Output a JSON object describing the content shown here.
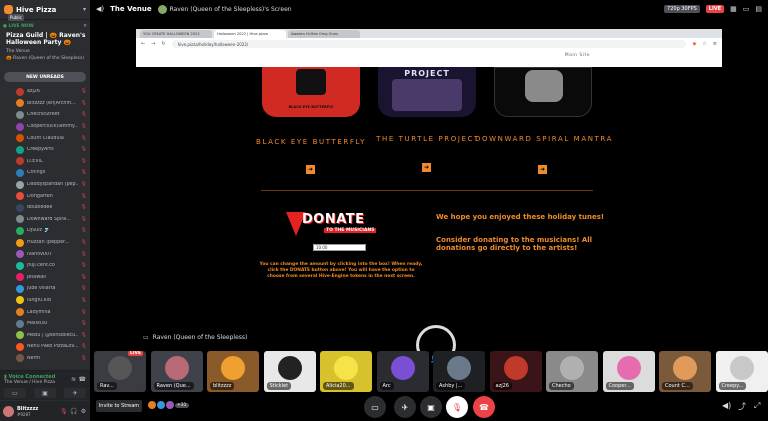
{
  "colors": {
    "accent_orange": "#f08a2a",
    "live_red": "#ed4245",
    "voice_green": "#3ba55d",
    "sidebar_bg": "#2b2d31"
  },
  "sidebar": {
    "server_name": "Hive Pizza",
    "public_badge": "Public",
    "live_label": "LIVE NOW",
    "event_title": "Pizza Guild | 🎃 Raven's Halloween Party 🎃",
    "event_sub": "The Venue",
    "event_user": "Raven (Queen of the Sleepless)",
    "new_unreads": "NEW UNREADS",
    "users": [
      {
        "name": "azj26",
        "color": "#c0392b"
      },
      {
        "name": "blitzzzz (elf|Archm...",
        "color": "#e67e22"
      },
      {
        "name": "ChechoStreet",
        "color": "#7f8c8d"
      },
      {
        "name": "Coopercluck(lammy...",
        "color": "#8e44ad"
      },
      {
        "name": "Count Claudula",
        "color": "#d35400"
      },
      {
        "name": "CreepyArts",
        "color": "#16a085"
      },
      {
        "name": "D.EVIL",
        "color": "#c0392b"
      },
      {
        "name": "Cthings",
        "color": "#2980b9"
      },
      {
        "name": "Daddyspandan (pep...",
        "color": "#95a5a6"
      },
      {
        "name": "Dorigarten",
        "color": "#e74c3c"
      },
      {
        "name": "doubledee",
        "color": "#34495e"
      },
      {
        "name": "Downward Spira...",
        "color": "#7f8c8d"
      },
      {
        "name": "DJSulz 🎐",
        "color": "#27ae60"
      },
      {
        "name": "Huzzah (pepper...",
        "color": "#f39c12"
      },
      {
        "name": "ivanov007",
        "color": "#9b59b6"
      },
      {
        "name": "jfuji.cent.co",
        "color": "#1abc9c"
      },
      {
        "name": "Jesswall",
        "color": "#e91e63"
      },
      {
        "name": "jude villarta",
        "color": "#3498db"
      },
      {
        "name": "lungfu.kid",
        "color": "#f1c40f"
      },
      {
        "name": "Ladymina",
        "color": "#e67e22"
      },
      {
        "name": "Maixo30",
        "color": "#607d8b"
      },
      {
        "name": "MeBu | @sensiblecu...",
        "color": "#8bc34a"
      },
      {
        "name": "Nehu Pako PizzaLov...",
        "color": "#ff5722"
      },
      {
        "name": "Nerm",
        "color": "#795548"
      }
    ],
    "voice_connected": "Voice Connected",
    "voice_location": "The Venue / Hive Pizza",
    "me_name": "Blitzzzz",
    "me_tag": "#9287"
  },
  "topbar": {
    "channel": "The Venue",
    "stream_title": "Raven (Queen of the Sleepless)'s Screen",
    "quality": "720p 30FPS",
    "live": "LIVE"
  },
  "browser": {
    "tabs": [
      "YOU CREATE HALLOWEEN 2022",
      "Halloween 2022 | Hive.pizza",
      "Awaken Hi-fide Omg Ones"
    ],
    "url": "hive.pizza/holiday/halloween-2022/",
    "main_site": "Main Site"
  },
  "page": {
    "albums": [
      {
        "title": "BLACK EYE BUTTERFLY",
        "logo_text": "BLACK EYE BUTTERFLY"
      },
      {
        "title": "THE TURTLE PROJECT",
        "logo_text": "PROJECT"
      },
      {
        "title": "DOWNWARD SPIRAL MANTRA",
        "logo_text": ""
      }
    ],
    "donate_logo": "DONATE",
    "donate_sub": "TO THE MUSICIANS",
    "amount": "10.00",
    "donate_text": "You can change the amount by clicking into the box! When ready, click the DONATE button above! You will have the option to choose from several Hive-Engine tokens in the next screen.",
    "hope": "We hope you enjoyed these holiday tunes!",
    "consider": "Consider donating to the musicians! All donations go directly to the artists!"
  },
  "stream_label": "Raven (Queen of the Sleepless)",
  "tiles": [
    {
      "name": "Rav...",
      "bg": "#3a3c42",
      "av": "#555",
      "live": "LIVE"
    },
    {
      "name": "Raven (Que...",
      "bg": "#404249",
      "av": "#b86b77"
    },
    {
      "name": "blitzzzz",
      "bg": "#8a5a2b",
      "av": "#f0a030"
    },
    {
      "name": "Sticklet",
      "bg": "#e8e8e8",
      "av": "#222"
    },
    {
      "name": "Alicia20...",
      "bg": "#d7c22e",
      "av": "#f5e34a"
    },
    {
      "name": "Arc",
      "bg": "#2a2c32",
      "av": "#7b4fd4"
    },
    {
      "name": "Ashby |...",
      "bg": "#1f2024",
      "av": "#6a7a8a"
    },
    {
      "name": "azj26",
      "bg": "#3a1418",
      "av": "#c0392b"
    },
    {
      "name": "Checho",
      "bg": "#8a8a8a",
      "av": "#b0b0b0"
    },
    {
      "name": "Cooper...",
      "bg": "#dcdcdc",
      "av": "#e66cb0"
    },
    {
      "name": "Count C...",
      "bg": "#7a5a3a",
      "av": "#e09a5a"
    },
    {
      "name": "Creepy...",
      "bg": "#f0f0f0",
      "av": "#c8c8c8"
    }
  ],
  "bottombar": {
    "invite": "Invite to Stream",
    "extra_count": "+31"
  }
}
